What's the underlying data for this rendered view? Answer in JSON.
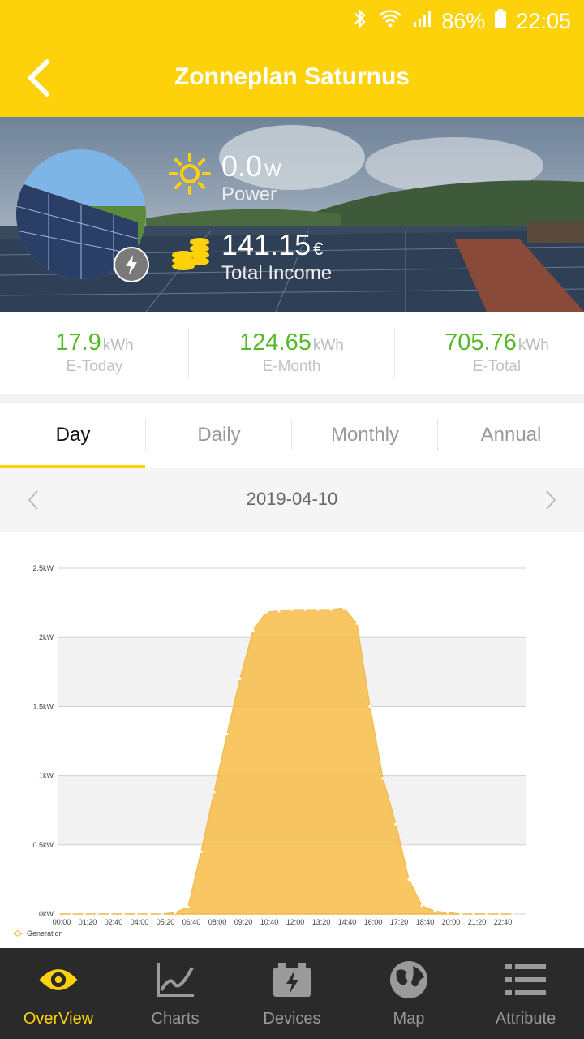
{
  "status": {
    "battery": "86%",
    "time": "22:05"
  },
  "header": {
    "title": "Zonneplan Saturnus"
  },
  "hero": {
    "power_value": "0.0",
    "power_unit": "W",
    "power_label": "Power",
    "income_value": "141.15",
    "income_unit": "€",
    "income_label": "Total Income"
  },
  "stats": [
    {
      "value": "17.9",
      "unit": "kWh",
      "label": "E-Today"
    },
    {
      "value": "124.65",
      "unit": "kWh",
      "label": "E-Month"
    },
    {
      "value": "705.76",
      "unit": "kWh",
      "label": "E-Total"
    }
  ],
  "tabs": [
    {
      "label": "Day",
      "active": true
    },
    {
      "label": "Daily"
    },
    {
      "label": "Monthly"
    },
    {
      "label": "Annual"
    }
  ],
  "date": "2019-04-10",
  "chart_data": {
    "type": "area",
    "series": [
      {
        "name": "Generation",
        "x": [
          "00:00",
          "00:40",
          "01:20",
          "02:00",
          "02:40",
          "03:20",
          "04:00",
          "04:40",
          "05:20",
          "06:00",
          "06:40",
          "07:20",
          "08:00",
          "08:40",
          "09:20",
          "10:00",
          "10:40",
          "11:20",
          "12:00",
          "12:40",
          "13:20",
          "14:00",
          "14:40",
          "15:20",
          "16:00",
          "16:40",
          "17:20",
          "18:00",
          "18:40",
          "19:20",
          "20:00",
          "20:40",
          "21:20",
          "22:00",
          "22:40",
          "23:20"
        ],
        "values": [
          0,
          0,
          0,
          0,
          0,
          0,
          0,
          0,
          0,
          0.01,
          0.05,
          0.45,
          0.88,
          1.3,
          1.7,
          2.05,
          2.18,
          2.19,
          2.2,
          2.2,
          2.2,
          2.2,
          2.21,
          2.1,
          1.5,
          0.98,
          0.65,
          0.25,
          0.06,
          0.02,
          0.01,
          0,
          0,
          0,
          0,
          0
        ]
      }
    ],
    "x_ticks": [
      "00:00",
      "01:20",
      "02:40",
      "04:00",
      "05:20",
      "06:40",
      "08:00",
      "09:20",
      "10:40",
      "12:00",
      "13:20",
      "14:40",
      "16:00",
      "17:20",
      "18:40",
      "20:00",
      "21:20",
      "22:40"
    ],
    "y_ticks": [
      "0kW",
      "0.5kW",
      "1kW",
      "1.5kW",
      "2kW",
      "2.5kW"
    ],
    "ylim": [
      0,
      2.5
    ],
    "legend": "bottom-left",
    "color": "#f7be4a"
  },
  "nav": [
    {
      "label": "OverView",
      "icon": "eye-icon",
      "active": true
    },
    {
      "label": "Charts",
      "icon": "line-chart-icon"
    },
    {
      "label": "Devices",
      "icon": "battery-icon"
    },
    {
      "label": "Map",
      "icon": "globe-icon"
    },
    {
      "label": "Attribute",
      "icon": "list-icon"
    }
  ],
  "colors": {
    "accent": "#fdd20a",
    "green": "#57b82a",
    "chart_fill": "#f7be4a",
    "nav_bg": "#2a2a2a"
  }
}
